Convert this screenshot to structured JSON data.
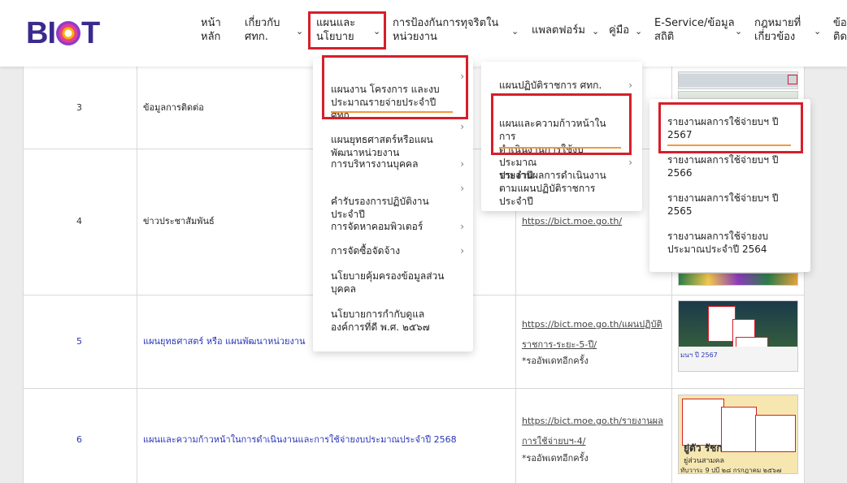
{
  "logo": {
    "text_left": "BI",
    "text_right": "T"
  },
  "nav": {
    "home": "หน้า\nหลัก",
    "about": "เกี่ยวกับ\nศทก.",
    "plan": "แผนและ\nนโยบาย",
    "anticorruption": "การป้องกันการทุจริตใน\nหน่วยงาน",
    "platform": "แพลตฟอร์ม",
    "manual": "คู่มือ",
    "eservice": "E-Service/ข้อมูล\nสถิติ",
    "law": "กฎหมายที่\nเกี่ยวข้อง",
    "more": "ข้อ\nติด",
    "chevron": "⌄"
  },
  "menu1": {
    "items": [
      "แผนงาน โครงการ และงบ\nประมาณรายจ่ายประจำปี\nศทก.",
      "แผนยุทธศาสตร์หรือแผน\nพัฒนาหน่วยงาน",
      "การบริหารงานบุคคล",
      "คำรับรองการปฏิบัติงาน\nประจำปี",
      "การจัดหาคอมพิวเตอร์",
      "การจัดซื้อจัดจ้าง",
      "นโยบายคุ้มครองข้อมูลส่วน\nบุคคล",
      "นโยบายการกำกับดูแล\nองค์การที่ดี พ.ศ. ๒๕๖๗"
    ],
    "arrow": "›"
  },
  "menu2": {
    "items": [
      "แผนปฏิบัติราชการ ศทก.",
      "แผนและความก้าวหน้าในการ\nดำเนินงานการใช้งบประมาณ\nประจำปี",
      "รายงานผลการดำเนินงาน\nตามแผนปฏิบัติราชการ\nประจำปี"
    ]
  },
  "menu3": {
    "items": [
      "รายงานผลการใช้จ่ายบฯ ปี\n2567",
      "รายงานผลการใช้จ่ายบฯ ปี\n2566",
      "รายงานผลการใช้จ่ายบฯ ปี\n2565",
      "รายงานผลการใช้จ่ายงบ\nประมาณประจำปี 2564"
    ]
  },
  "table": {
    "rows": [
      {
        "num": "3",
        "title": "ข้อมูลการติดต่อ"
      },
      {
        "num": "4",
        "title": "ข่าวประชาสัมพันธ์",
        "url": "https://bict.moe.go.th/"
      },
      {
        "num": "5",
        "title": "แผนยุทธศาสตร์ หรือ แผนพัฒนาหน่วยงาน",
        "url": "https://bict.moe.go.th/แผนปฏิบัติ\nราชการ-ระยะ-5-ปี/",
        "note": "*รออัพเดทอีกครั้ง"
      },
      {
        "num": "6",
        "title": "แผนและความก้าวหน้าในการดำเนินงานและการใช้จ่ายงบประมาณประจำปี 2568",
        "url": "https://bict.moe.go.th/รายงานผล\nการใช้จ่ายบฯ-4/",
        "note": "*รออัพเดทอีกครั้ง"
      }
    ]
  },
  "thumbs": {
    "t5_text": "มนฯ ปี 2567",
    "t6_text": "ยู่ตัว รัชก",
    "t6_text2": "ยู่ส่วนสามคล",
    "t6_text3": "ทับวาระ 9 ปบี ๒๘ กรกฎาคม ๒๕๖๗"
  },
  "colors": {
    "highlight": "#d61f2a",
    "underline": "#f29a3a",
    "link": "#2b35b5"
  }
}
